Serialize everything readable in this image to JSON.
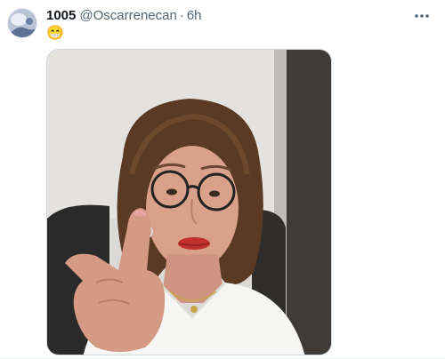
{
  "post": {
    "display_name": "1005",
    "handle": "@Oscarrenecan",
    "separator": "·",
    "time": "6h",
    "text": "😁"
  },
  "icons": {
    "avatar": "profile-avatar",
    "more": "more-horizontal-icon"
  },
  "media": {
    "type": "video-still",
    "subject": "photo"
  }
}
